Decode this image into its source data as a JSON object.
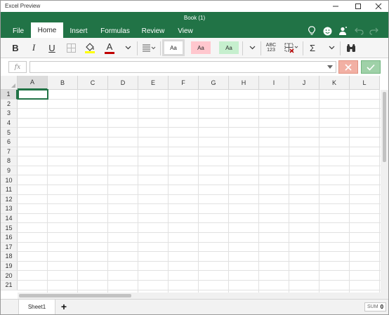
{
  "window": {
    "app_title": "Excel Preview",
    "controls": [
      "minimize",
      "maximize",
      "close"
    ]
  },
  "header": {
    "book_title": "Book (1)",
    "tabs": [
      {
        "label": "File",
        "active": false
      },
      {
        "label": "Home",
        "active": true
      },
      {
        "label": "Insert",
        "active": false
      },
      {
        "label": "Formulas",
        "active": false
      },
      {
        "label": "Review",
        "active": false
      },
      {
        "label": "View",
        "active": false
      }
    ],
    "right_icons": [
      "lightbulb-icon",
      "smiley-icon",
      "share-people-icon",
      "undo-icon",
      "redo-icon"
    ]
  },
  "ribbon": {
    "bold": "B",
    "italic": "I",
    "underline": "U",
    "font_color_letter": "A",
    "styles": [
      {
        "label": "Aa",
        "color": "#ffffff"
      },
      {
        "label": "Aa",
        "color": "#ffc7ce"
      },
      {
        "label": "Aa",
        "color": "#c6efce"
      }
    ],
    "spell_top": "ABC",
    "spell_bottom": "123",
    "sum_symbol": "Σ",
    "accent_red": "#c00000",
    "fill_yellow": "#ffff00"
  },
  "formula_bar": {
    "fx_label": "fx",
    "value": ""
  },
  "grid": {
    "columns": [
      "A",
      "B",
      "C",
      "D",
      "E",
      "F",
      "G",
      "H",
      "I",
      "J",
      "K",
      "L"
    ],
    "rows": [
      "1",
      "2",
      "3",
      "4",
      "5",
      "6",
      "7",
      "8",
      "9",
      "10",
      "11",
      "12",
      "13",
      "14",
      "15",
      "16",
      "17",
      "18",
      "19",
      "20",
      "21"
    ],
    "active_cell": "A1"
  },
  "statusbar": {
    "sheet_tab": "Sheet1",
    "add_sheet": "+",
    "sum_label": "SUM",
    "sum_value": "0"
  },
  "colors": {
    "brand_green": "#217346"
  }
}
